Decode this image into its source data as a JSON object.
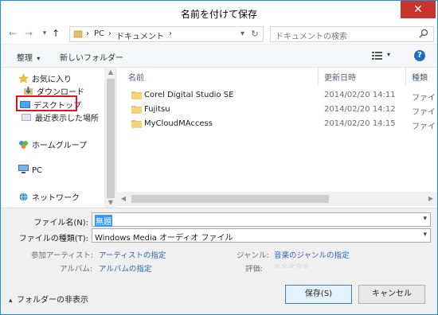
{
  "window": {
    "title": "名前を付けて保存",
    "close_glyph": "✕"
  },
  "nav": {
    "back_glyph": "←",
    "forward_glyph": "→",
    "up_glyph": "↑",
    "breadcrumb": [
      "PC",
      "ドキュメント"
    ],
    "breadcrumb_sep": "›",
    "refresh_glyph": "↻"
  },
  "search": {
    "placeholder": "ドキュメントの検索"
  },
  "toolbar": {
    "organize_label": "整理",
    "organize_chevron": "▾",
    "new_folder_label": "新しいフォルダー",
    "view_chevron": "▾",
    "help_glyph": "?"
  },
  "tree": {
    "favorites": "お気に入り",
    "downloads": "ダウンロード",
    "desktop": "デスクトップ",
    "recent": "最近表示した場所",
    "homegroup": "ホームグループ",
    "pc": "PC",
    "network": "ネットワーク"
  },
  "columns": {
    "name": "名前",
    "date": "更新日時",
    "type": "種類"
  },
  "files": [
    {
      "name": "Corel Digital Studio SE",
      "date": "2014/02/20 14:11",
      "type": "ファイ"
    },
    {
      "name": "Fujitsu",
      "date": "2014/02/20 14:12",
      "type": "ファイ"
    },
    {
      "name": "MyCloudMAccess",
      "date": "2014/02/20 14:15",
      "type": "ファイ"
    }
  ],
  "form": {
    "filename_label": "ファイル名(N):",
    "filename_value": "無題",
    "filetype_label": "ファイルの種類(T):",
    "filetype_value": "Windows Media オーディオ ファイル",
    "dropdown_glyph": "▾"
  },
  "meta": {
    "artist_label": "参加アーティスト:",
    "artist_link": "アーティストの指定",
    "album_label": "アルバム:",
    "album_link": "アルバムの指定",
    "genre_label": "ジャンル:",
    "genre_link": "音楽のジャンルの指定",
    "rating_label": "評価:",
    "rating_stars": "☆☆☆☆☆"
  },
  "buttons": {
    "save": "保存(S)",
    "cancel": "キャンセル"
  },
  "hide_folders": {
    "label": "フォルダーの非表示",
    "chevron": "▴"
  },
  "scroll_glyphs": {
    "up": "▲",
    "down": "▼",
    "left": "◀",
    "right": "▶"
  },
  "colors": {
    "accent": "#1e8fd8",
    "close": "#c7342b",
    "link": "#2a64b0",
    "highlight": "#e0151b"
  }
}
